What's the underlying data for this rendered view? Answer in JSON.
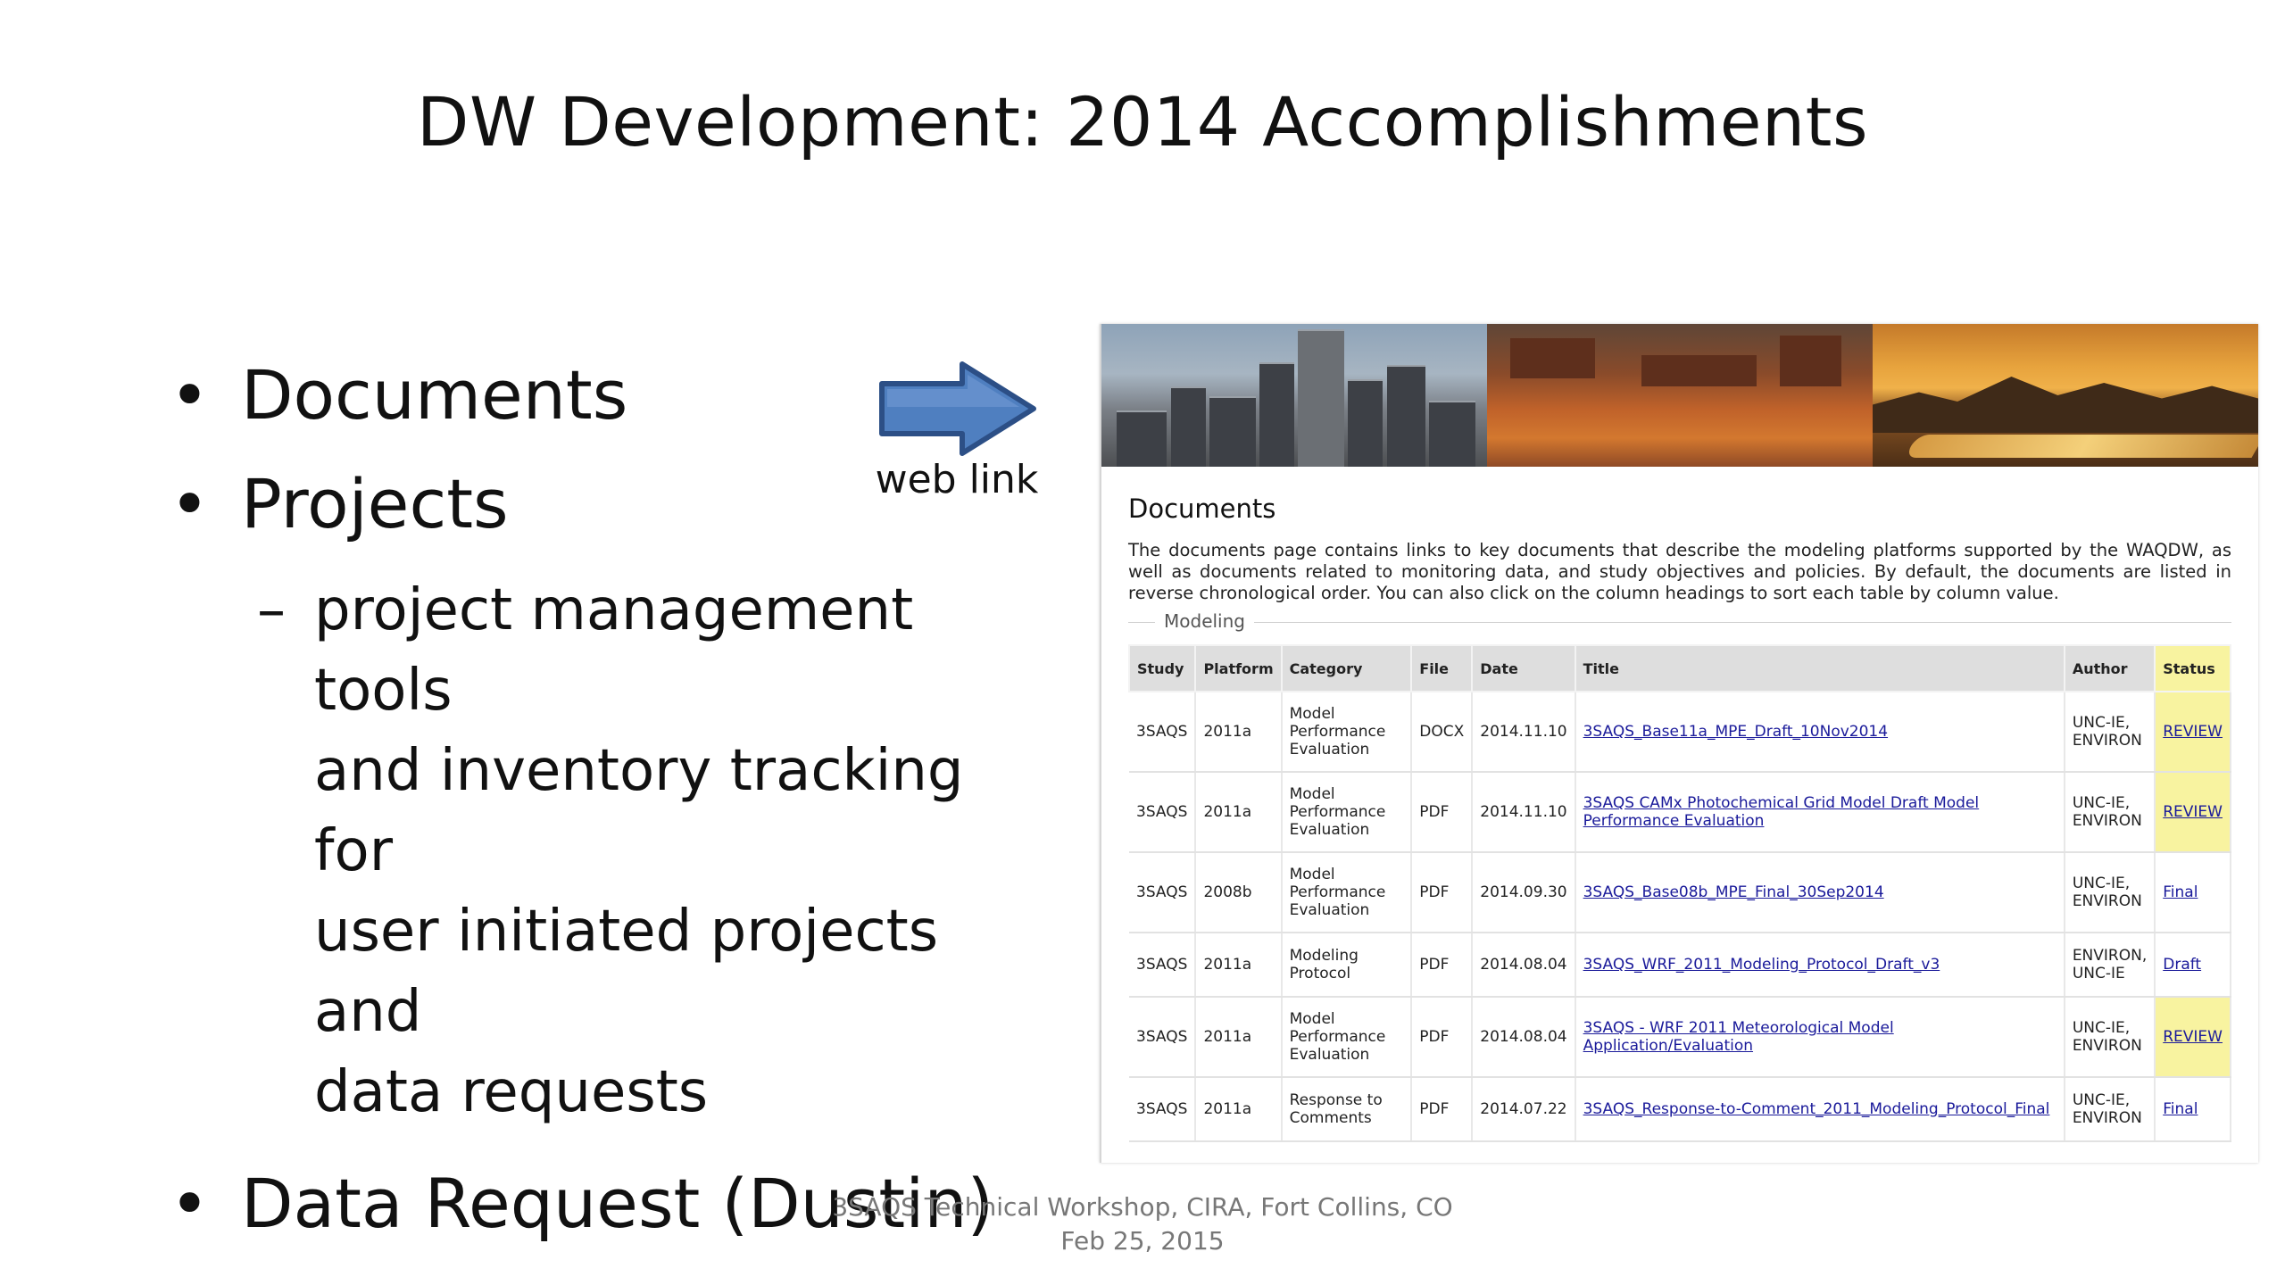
{
  "slide": {
    "title": "DW Development: 2014 Accomplishments",
    "bullets": [
      {
        "text": "Documents"
      },
      {
        "text": "Projects"
      }
    ],
    "sub_dash": "–",
    "sub_lines": [
      "project management tools",
      "and inventory tracking for",
      "user initiated projects and",
      "data requests"
    ],
    "bullet3": "Data Request (Dustin)",
    "arrow_icon": "right-arrow-icon",
    "arrow_color": "#4f7fc0",
    "web_link_label": "web link"
  },
  "screenshot": {
    "heading": "Documents",
    "intro": "The documents page contains links to key documents that describe the modeling platforms supported by the WAQDW, as well as documents related to monitoring data, and study objectives and policies. By default, the documents are listed in reverse chronological order. You can also click on the column headings to sort each table by column value.",
    "legend": "Modeling",
    "columns": [
      "Study",
      "Platform",
      "Category",
      "File",
      "Date",
      "Title",
      "Author",
      "Status"
    ],
    "rows": [
      {
        "study": "3SAQS",
        "platform": "2011a",
        "category": "Model Performance Evaluation",
        "file": "DOCX",
        "date": "2014.11.10",
        "title": "3SAQS_Base11a_MPE_Draft_10Nov2014",
        "author": "UNC-IE, ENVIRON",
        "status": "REVIEW",
        "highlight": true
      },
      {
        "study": "3SAQS",
        "platform": "2011a",
        "category": "Model Performance Evaluation",
        "file": "PDF",
        "date": "2014.11.10",
        "title": "3SAQS CAMx Photochemical Grid Model Draft Model Performance Evaluation",
        "author": "UNC-IE, ENVIRON",
        "status": "REVIEW",
        "highlight": true
      },
      {
        "study": "3SAQS",
        "platform": "2008b",
        "category": "Model Performance Evaluation",
        "file": "PDF",
        "date": "2014.09.30",
        "title": "3SAQS_Base08b_MPE_Final_30Sep2014",
        "author": "UNC-IE, ENVIRON",
        "status": "Final",
        "highlight": false
      },
      {
        "study": "3SAQS",
        "platform": "2011a",
        "category": "Modeling Protocol",
        "file": "PDF",
        "date": "2014.08.04",
        "title": "3SAQS_WRF_2011_Modeling_Protocol_Draft_v3",
        "author": "ENVIRON, UNC-IE",
        "status": "Draft",
        "highlight": false
      },
      {
        "study": "3SAQS",
        "platform": "2011a",
        "category": "Model Performance Evaluation",
        "file": "PDF",
        "date": "2014.08.04",
        "title": "3SAQS - WRF 2011 Meteorological Model Application/Evaluation",
        "author": "UNC-IE, ENVIRON",
        "status": "REVIEW",
        "highlight": true
      },
      {
        "study": "3SAQS",
        "platform": "2011a",
        "category": "Response to Comments",
        "file": "PDF",
        "date": "2014.07.22",
        "title": "3SAQS_Response-to-Comment_2011_Modeling_Protocol_Final",
        "author": "UNC-IE, ENVIRON",
        "status": "Final",
        "highlight": false
      }
    ],
    "highlight_color": "#f8f3a0",
    "link_color": "#1a1a9a"
  },
  "footer": {
    "line1": "3SAQS Technical Workshop,  CIRA, Fort Collins, CO",
    "line2": "Feb 25, 2015"
  }
}
